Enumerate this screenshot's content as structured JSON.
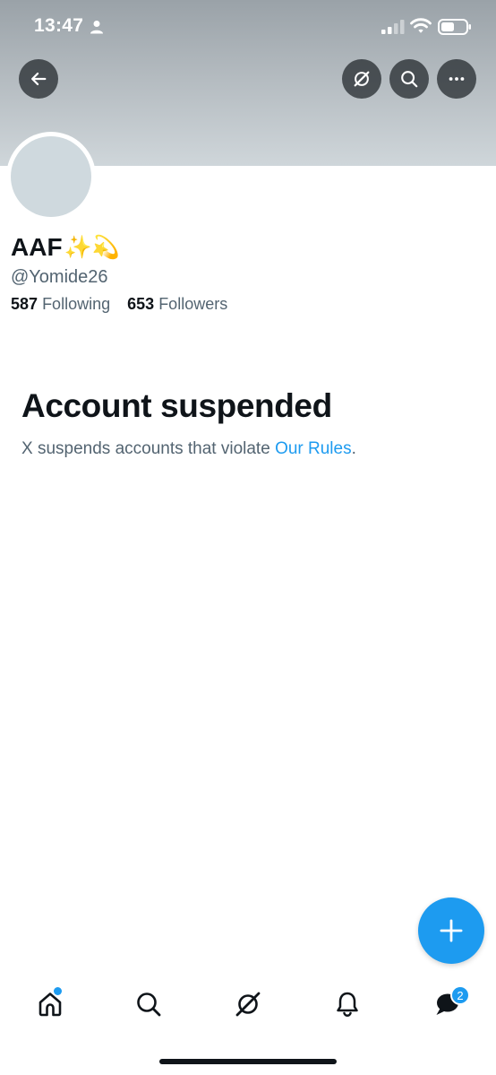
{
  "status_bar": {
    "time": "13:47"
  },
  "profile": {
    "display_name": "AAF",
    "name_emoji": "✨💫",
    "handle": "@Yomide26",
    "following_count": "587",
    "following_label": "Following",
    "followers_count": "653",
    "followers_label": "Followers"
  },
  "suspension": {
    "title": "Account suspended",
    "message": "X suspends accounts that violate ",
    "rules_link": "Our Rules",
    "period": "."
  },
  "tabbar": {
    "messages_badge": "2"
  },
  "icons": {
    "top": [
      "back-arrow-icon",
      "grok-icon",
      "search-icon",
      "more-icon"
    ],
    "bottom": [
      "home-icon",
      "search-icon",
      "grok-icon",
      "bell-icon",
      "messages-icon"
    ],
    "fab": "plus-icon"
  },
  "colors": {
    "accent": "#1d9bf0",
    "text": "#0f1419",
    "secondary": "#536471",
    "avatar": "#cfd9de"
  }
}
